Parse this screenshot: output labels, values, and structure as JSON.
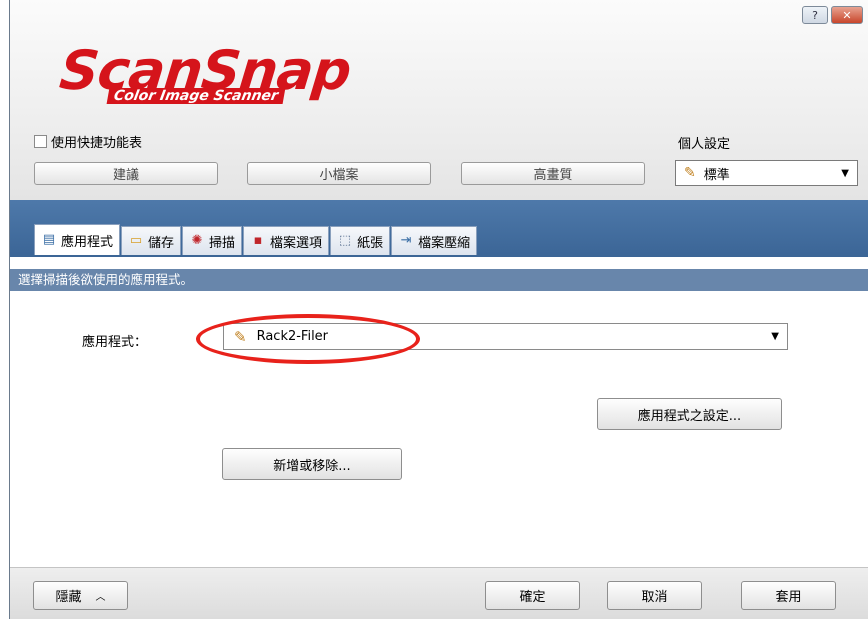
{
  "window": {
    "help_label": "?",
    "close_label": "✕"
  },
  "logo": {
    "title": "ScanSnap",
    "subtitle": "Color Image Scanner"
  },
  "header": {
    "quick_menu_label": "使用快捷功能表",
    "profile_label": "個人設定",
    "presets": [
      "建議",
      "小檔案",
      "高畫質"
    ],
    "profile_value": "標準"
  },
  "tabs": [
    {
      "label": "應用程式",
      "icon": "app-icon"
    },
    {
      "label": "儲存",
      "icon": "folder-icon"
    },
    {
      "label": "掃描",
      "icon": "scan-icon"
    },
    {
      "label": "檔案選項",
      "icon": "file-icon"
    },
    {
      "label": "紙張",
      "icon": "paper-icon"
    },
    {
      "label": "檔案壓縮",
      "icon": "compress-icon"
    }
  ],
  "content": {
    "instruction": "選擇掃描後欲使用的應用程式。",
    "app_label": "應用程式：",
    "app_value": "Rack2-Filer",
    "app_settings_button": "應用程式之設定...",
    "add_remove_button": "新增或移除..."
  },
  "footer": {
    "hide_button": "隱藏",
    "ok_button": "確定",
    "cancel_button": "取消",
    "apply_button": "套用"
  },
  "colors": {
    "brand_red": "#d5141b",
    "tab_band": "#4e79aa",
    "subhead": "#6886ab",
    "highlight": "#e8221b"
  }
}
